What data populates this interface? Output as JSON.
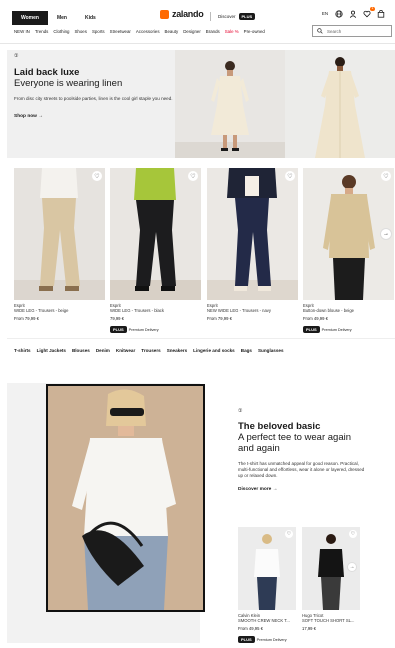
{
  "header": {
    "tabs": [
      "Women",
      "Men",
      "Kids"
    ],
    "active_tab": "Women",
    "logo": "zalando",
    "discover_label": "Discover",
    "plus_badge": "PLUS",
    "lang": "EN",
    "bag_count": "1",
    "nav": [
      "NEW IN",
      "Trends",
      "Clothing",
      "Shoes",
      "Sports",
      "Streetwear",
      "Accessories",
      "Beauty",
      "Designer",
      "Brands",
      "Sale %",
      "Pre-owned"
    ],
    "search_placeholder": "Search"
  },
  "hero": {
    "tag": "①",
    "title": "Laid back luxe",
    "subtitle": "Everyone is wearing linen",
    "description": "From disc city streets to poolside parties, linen is the cool girl staple you need.",
    "link": "Shop now →"
  },
  "products": [
    {
      "brand": "Esprit",
      "name": "WIDE LEG - Trousers - beige",
      "price": "From 79,99 €",
      "plus": ""
    },
    {
      "brand": "Esprit",
      "name": "WIDE LEG - Trousers - black",
      "price": "79,99 €",
      "plus": "Premium Delivery"
    },
    {
      "brand": "Esprit",
      "name": "NEW WIDE LEG - Trousers - navy",
      "price": "From 79,99 €",
      "plus": ""
    },
    {
      "brand": "Esprit",
      "name": "Button-down blouse - beige",
      "price": "From 49,99 €",
      "plus": "Premium Delivery"
    }
  ],
  "categories": [
    "T-shirts",
    "Light Jackets",
    "Blouses",
    "Denim",
    "Knitwear",
    "Trousers",
    "Sneakers",
    "Lingerie and socks",
    "Bags",
    "Sunglasses"
  ],
  "basic": {
    "tag": "①",
    "title": "The beloved basic",
    "subtitle": "A perfect tee to wear again and again",
    "description": "The t-shirt has unmatched appeal for good reason. Practical, multi-functional and effortless, wear it alone or layered, dressed up or relaxed down.",
    "link": "Discover more →"
  },
  "small_products": [
    {
      "brand": "Calvin Klein",
      "name": "SMOOTH CREW NECK T...",
      "price": "From 49,95 €",
      "plus": "Premium Delivery"
    },
    {
      "brand": "Hugo Tricot",
      "name": "SOFT TOUCH SHORT SL...",
      "price": "17,99 €",
      "plus": ""
    }
  ],
  "colors": {
    "brand_orange": "#ff6900",
    "sale_red": "#e5002c",
    "dark": "#1a1a1a"
  }
}
